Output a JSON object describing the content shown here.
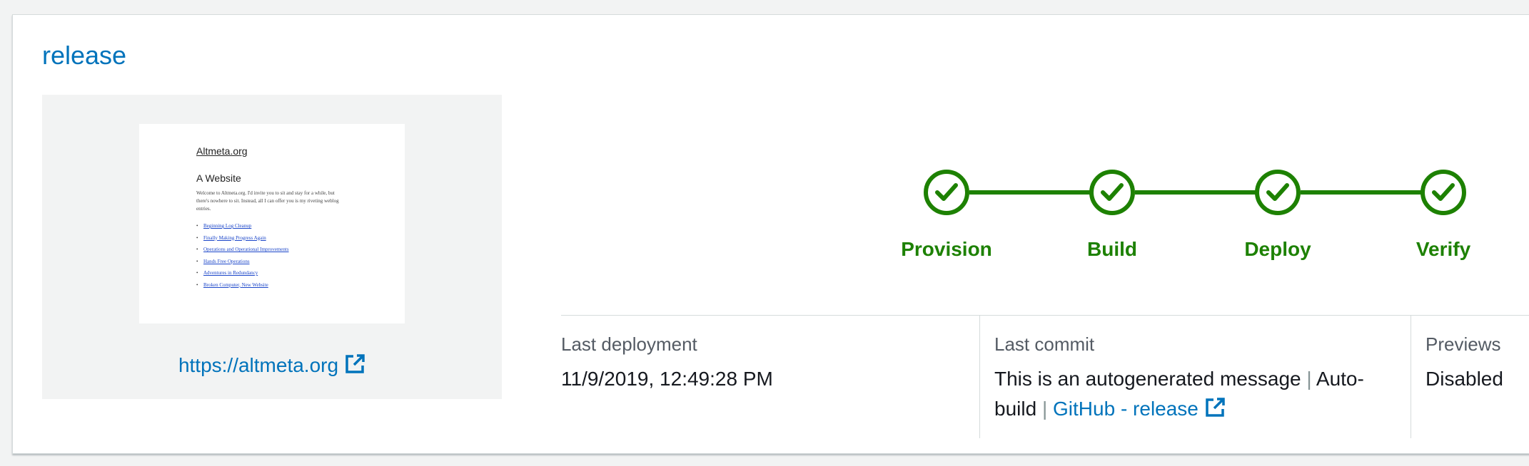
{
  "branch": {
    "title": "release"
  },
  "preview": {
    "site_name": "Altmeta.org",
    "heading": "A Website",
    "body": "Welcome to Altmeta.org. I'd invite you to sit and stay for a while, but there's nowhere to sit. Instead, all I can offer you is my riveting weblog entries.",
    "posts": [
      "Beginning Log Cleanup",
      "Finally Making Progress Again",
      "Operations and Operational Improvements",
      "Hands Free Operations",
      "Adventures in Redundancy",
      "Broken Computer, New Website"
    ],
    "link_text": "https://altmeta.org",
    "link_icon": "external-link-icon"
  },
  "pipeline": {
    "status_color": "#1d8102",
    "steps": [
      {
        "label": "Provision",
        "status": "succeeded",
        "icon": "check-icon"
      },
      {
        "label": "Build",
        "status": "succeeded",
        "icon": "check-icon"
      },
      {
        "label": "Deploy",
        "status": "succeeded",
        "icon": "check-icon"
      },
      {
        "label": "Verify",
        "status": "succeeded",
        "icon": "check-icon"
      }
    ]
  },
  "details": {
    "last_deployment": {
      "label": "Last deployment",
      "value": "11/9/2019, 12:49:28 PM"
    },
    "last_commit": {
      "label": "Last commit",
      "message": "This is an autogenerated message",
      "separator": "|",
      "source_line1": "Auto-",
      "source_line2": "build",
      "link_text": "GitHub - release",
      "link_icon": "external-link-icon"
    },
    "previews": {
      "label": "Previews",
      "value": "Disabled"
    }
  }
}
